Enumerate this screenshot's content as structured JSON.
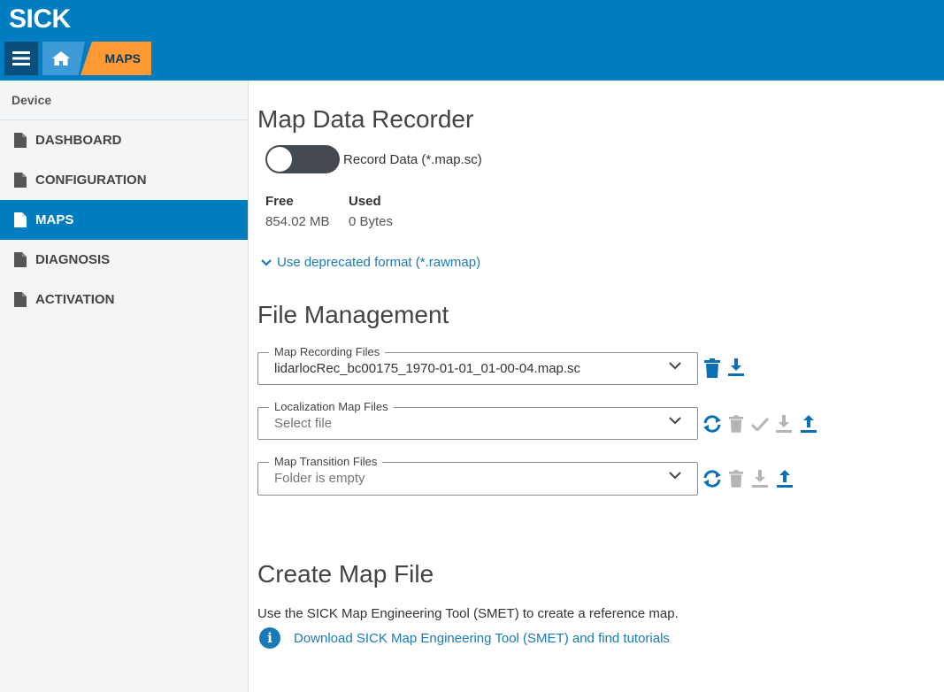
{
  "header": {
    "logo": "SICK",
    "breadcrumb_current": "MAPS"
  },
  "sidebar": {
    "heading": "Device",
    "items": [
      {
        "label": "DASHBOARD",
        "icon": "document-icon",
        "active": false
      },
      {
        "label": "CONFIGURATION",
        "icon": "document-icon",
        "active": false
      },
      {
        "label": "MAPS",
        "icon": "document-icon",
        "active": true
      },
      {
        "label": "DIAGNOSIS",
        "icon": "document-icon",
        "active": false
      },
      {
        "label": "ACTIVATION",
        "icon": "document-icon",
        "active": false
      }
    ]
  },
  "recorder": {
    "title": "Map Data Recorder",
    "toggle_label": "Record Data (*.map.sc)",
    "toggle_on": false,
    "free_label": "Free",
    "free_value": "854.02 MB",
    "used_label": "Used",
    "used_value": "0 Bytes",
    "deprecated_link": "Use deprecated format (*.rawmap)"
  },
  "file_management": {
    "title": "File Management",
    "recording": {
      "legend": "Map Recording Files",
      "value": "lidarlocRec_bc00175_1970-01-01_01-00-04.map.sc"
    },
    "localization": {
      "legend": "Localization Map Files",
      "placeholder": "Select file"
    },
    "transition": {
      "legend": "Map Transition Files",
      "placeholder": "Folder is empty"
    }
  },
  "create_map": {
    "title": "Create Map File",
    "description": "Use the SICK Map Engineering Tool (SMET) to create a reference map.",
    "info_glyph": "i",
    "link": "Download SICK Map Engineering Tool (SMET) and find tutorials"
  },
  "colors": {
    "brand_blue": "#007cc1",
    "breadcrumb_orange": "#ff9933",
    "link_blue": "#1a7ab8",
    "disabled_gray": "#b5b5b5"
  }
}
